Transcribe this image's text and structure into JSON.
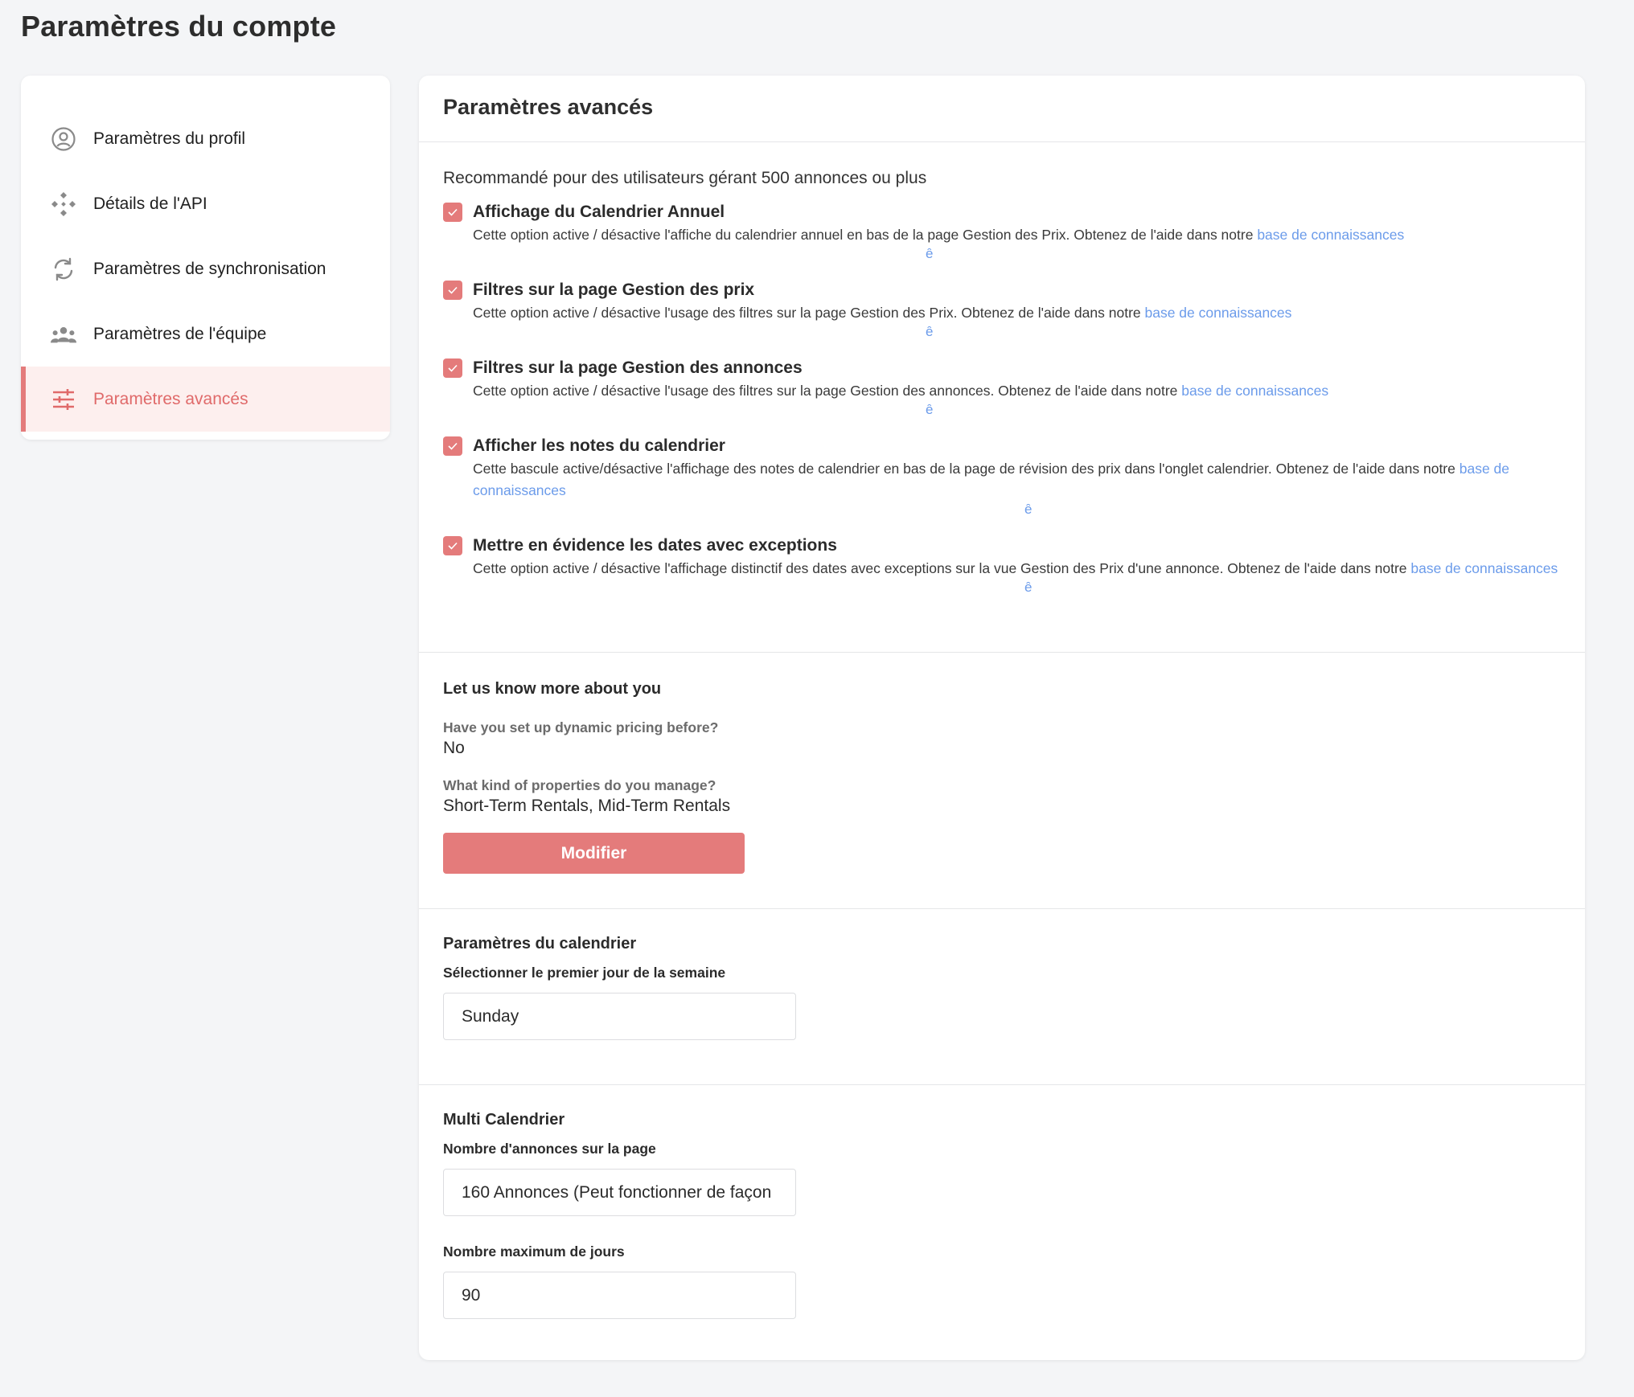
{
  "page_title": "Paramètres du compte",
  "sidebar": {
    "items": [
      {
        "label": "Paramètres du profil",
        "icon": "user-circle-icon"
      },
      {
        "label": "Détails de l'API",
        "icon": "api-diamond-icon"
      },
      {
        "label": "Paramètres de synchronisation",
        "icon": "sync-icon"
      },
      {
        "label": "Paramètres de l'équipe",
        "icon": "team-icon"
      },
      {
        "label": "Paramètres avancés",
        "icon": "sliders-icon",
        "active": true
      }
    ]
  },
  "main": {
    "title": "Paramètres avancés",
    "recommendation": "Recommandé pour des utilisateurs gérant 500 annonces ou plus",
    "options": [
      {
        "title": "Affichage du Calendrier Annuel",
        "description": "Cette option active / désactive l'affiche du calendrier annuel en bas de la page Gestion des Prix. Obtenez de l'aide dans notre ",
        "link": "base de connaissances",
        "mark": "ȇ",
        "checked": true
      },
      {
        "title": "Filtres sur la page Gestion des prix",
        "description": "Cette option active / désactive l'usage des filtres sur la page Gestion des Prix. Obtenez de l'aide dans notre ",
        "link": "base de connaissances",
        "mark": "ȇ",
        "checked": true
      },
      {
        "title": "Filtres sur la page Gestion des annonces",
        "description": "Cette option active / désactive l'usage des filtres sur la page Gestion des annonces. Obtenez de l'aide dans notre ",
        "link": "base de connaissances",
        "mark": "ȇ",
        "checked": true
      },
      {
        "title": "Afficher les notes du calendrier",
        "description": "Cette bascule active/désactive l'affichage des notes de calendrier en bas de la page de révision des prix dans l'onglet calendrier. Obtenez de l'aide dans notre ",
        "link": "base de connaissances",
        "mark": "ȇ",
        "checked": true
      },
      {
        "title": "Mettre en évidence les dates avec exceptions",
        "description": "Cette option active / désactive l'affichage distinctif des dates avec exceptions sur la vue Gestion des Prix d'une annonce. Obtenez de l'aide dans notre ",
        "link": "base de connaissances",
        "mark": "ȇ",
        "checked": true
      }
    ],
    "about": {
      "title": "Let us know more about you",
      "q1": "Have you set up dynamic pricing before?",
      "a1": "No",
      "q2": "What kind of properties do you manage?",
      "a2": "Short-Term Rentals, Mid-Term Rentals",
      "button": "Modifier"
    },
    "calendar": {
      "title": "Paramètres du calendrier",
      "label": "Sélectionner le premier jour de la semaine",
      "value": "Sunday"
    },
    "multi": {
      "title": "Multi Calendrier",
      "label1": "Nombre d'annonces sur la page",
      "value1": "160 Annonces (Peut fonctionner de façon",
      "label2": "Nombre maximum de jours",
      "value2": "90"
    }
  },
  "colors": {
    "accent": "#e47b7b",
    "link": "#6b9bea",
    "active_bg": "#fdefee"
  }
}
